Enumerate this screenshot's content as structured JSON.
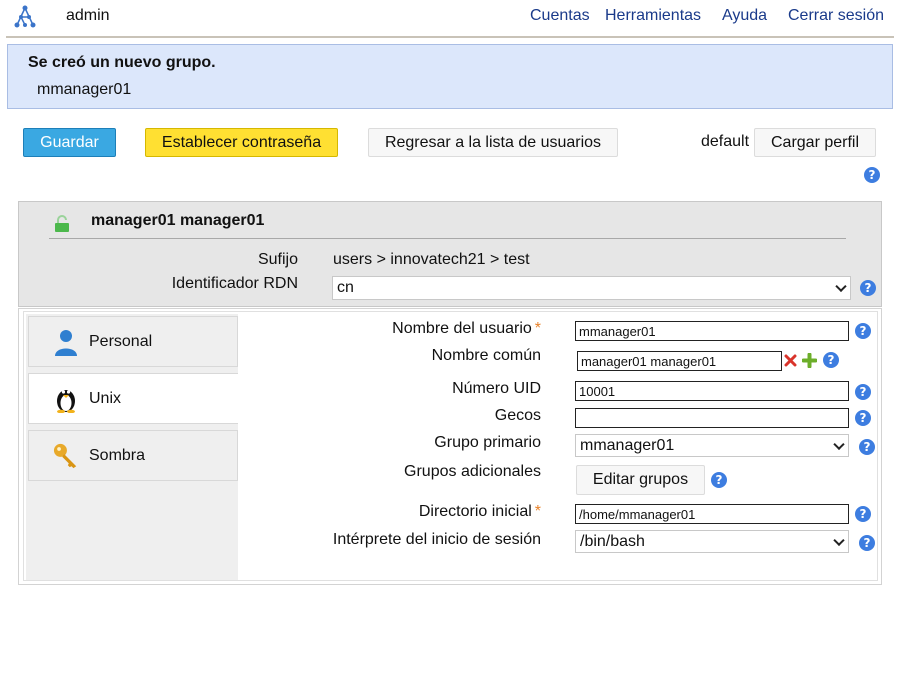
{
  "topbar": {
    "user": "admin",
    "nav": [
      "Cuentas",
      "Herramientas",
      "Ayuda",
      "Cerrar sesión"
    ]
  },
  "message": {
    "title": "Se creó un nuevo grupo.",
    "body": "mmanager01"
  },
  "toolbar": {
    "save": "Guardar",
    "set_password": "Establecer contraseña",
    "back": "Regresar a la lista de usuarios",
    "profile": "default",
    "load_profile": "Cargar perfil"
  },
  "header": {
    "name": "manager01 manager01",
    "suffix_label": "Sufijo",
    "suffix_value": "users > innovatech21 > test",
    "rdn_label": "Identificador RDN",
    "rdn_value": "cn"
  },
  "tabs": [
    {
      "label": "Personal",
      "icon": "user-icon"
    },
    {
      "label": "Unix",
      "icon": "penguin-icon"
    },
    {
      "label": "Sombra",
      "icon": "key-icon"
    }
  ],
  "form": {
    "username_label": "Nombre del usuario",
    "username_value": "mmanager01",
    "common_name_label": "Nombre común",
    "common_name_value": "manager01 manager01",
    "uid_label": "Número UID",
    "uid_value": "10001",
    "gecos_label": "Gecos",
    "gecos_value": "",
    "primary_group_label": "Grupo primario",
    "primary_group_value": "mmanager01",
    "additional_groups_label": "Grupos adicionales",
    "edit_groups": "Editar grupos",
    "home_label": "Directorio inicial",
    "home_value": "/home/mmanager01",
    "shell_label": "Intérprete del inicio de sesión",
    "shell_value": "/bin/bash",
    "required_mark": "*"
  },
  "help_symbol": "?",
  "colors": {
    "save_button": "#3aa8e2",
    "password_button": "#ffe032",
    "message_bg": "#dce7fb",
    "help_icon": "#3d7de0",
    "required": "#e8822a",
    "nav_link": "#1a3a8a"
  }
}
